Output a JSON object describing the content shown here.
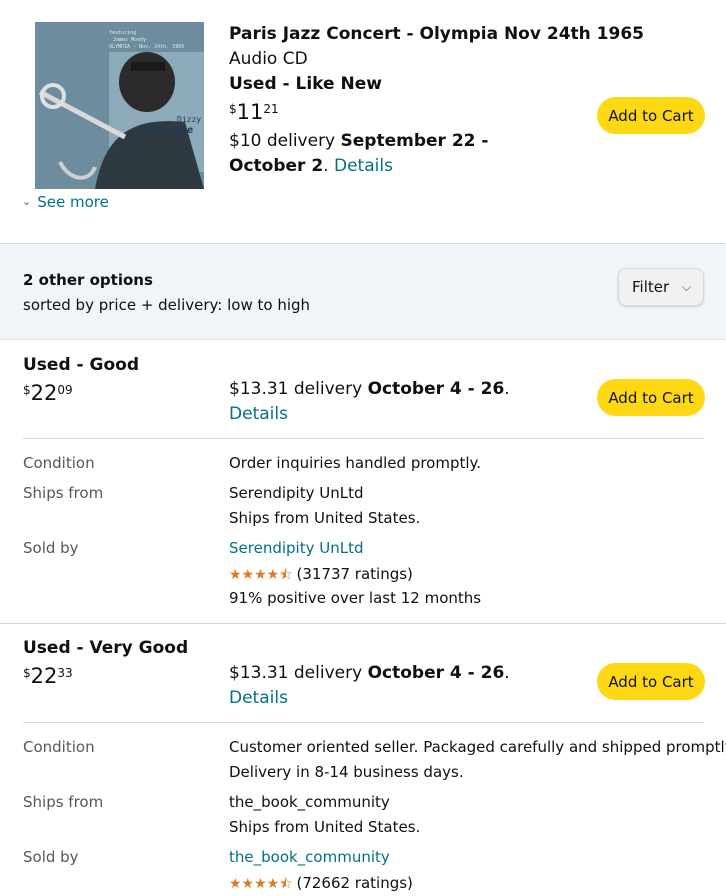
{
  "product": {
    "title": "Paris Jazz Concert - Olympia Nov 24th 1965",
    "format": "Audio CD",
    "condition": "Used - Like New",
    "price": {
      "symbol": "$",
      "whole": "11",
      "fraction": "21"
    },
    "delivery_prefix": "$10 delivery ",
    "delivery_dates": "September 22 - October 2",
    "delivery_suffix": ". ",
    "details_link": "Details",
    "see_more": "See more",
    "cover_text": {
      "line1": "Dizzy",
      "line2": "Gillespie",
      "top1": "featuring",
      "top2": "James Moody",
      "top3": "OLYMPIA - Nov. 24th. 1965"
    }
  },
  "add_to_cart_label": "Add to Cart",
  "options": {
    "count_label": "2 other options",
    "sort_label": "sorted by price + delivery: low to high",
    "filter_label": "Filter"
  },
  "labels": {
    "condition": "Condition",
    "ships_from": "Ships from",
    "sold_by": "Sold by"
  },
  "offers": [
    {
      "condition": "Used - Good",
      "price": {
        "symbol": "$",
        "whole": "22",
        "fraction": "09"
      },
      "delivery_prefix": "$13.31 delivery ",
      "delivery_dates": "October 4 - 26",
      "delivery_suffix": ".",
      "details_link": "Details",
      "condition_note": [
        "Order inquiries handled promptly."
      ],
      "ships_from": "Serendipity UnLtd",
      "ships_from_country": "Ships from United States.",
      "seller": "Serendipity UnLtd",
      "rating_stars": 4.5,
      "ratings": "(31737 ratings)",
      "positive": "91% positive over last 12 months"
    },
    {
      "condition": "Used - Very Good",
      "price": {
        "symbol": "$",
        "whole": "22",
        "fraction": "33"
      },
      "delivery_prefix": "$13.31 delivery ",
      "delivery_dates": "October 4 - 26",
      "delivery_suffix": ".",
      "details_link": "Details",
      "condition_note": [
        "Customer oriented seller. Packaged carefully and shipped promptly.",
        "Delivery in 8-14 business days."
      ],
      "ships_from": "the_book_community",
      "ships_from_country": "Ships from United States.",
      "seller": "the_book_community",
      "rating_stars": 4.5,
      "ratings": "(72662 ratings)"
    }
  ],
  "colors": {
    "accent_button": "#ffd814",
    "link": "#007185",
    "star": "#de7921",
    "options_bg": "#f0f5f7"
  }
}
